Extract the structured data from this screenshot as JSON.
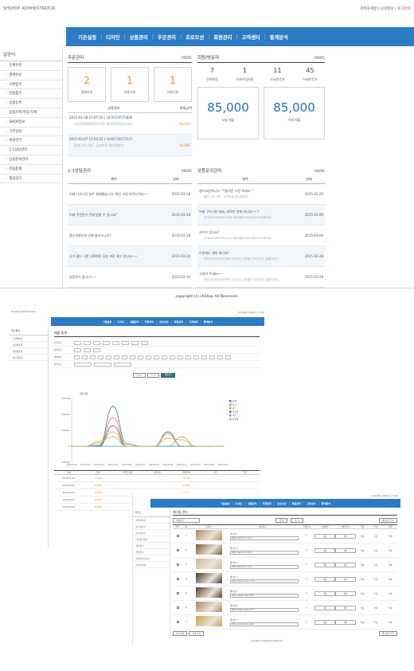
{
  "screen1": {
    "brand": "SHSHOP ADMINISTRATOR",
    "top_links": {
      "user": "관리자계정",
      "sep": " | ",
      "info": "나의정보",
      "logout": "로그아웃"
    },
    "nav": [
      "기본설정",
      "디자인",
      "상품관리",
      "주문관리",
      "프로모션",
      "회원관리",
      "고객센터",
      "통계분석"
    ],
    "sidebar": {
      "title": "샵관리",
      "items": [
        "전체주문",
        "결제완료",
        "교환접수",
        "반품접수",
        "상품등록",
        "상품목록/이동/삭제",
        "SHOP정보",
        "기본설정",
        "회원관리",
        "1:1상담관리",
        "상품문의관리",
        "마음통계",
        "월정관리"
      ]
    },
    "orders": {
      "title": "주문관리",
      "more": "MORE",
      "stats": [
        {
          "value": "2",
          "label": "결제완료"
        },
        {
          "value": "1",
          "label": "반품신청"
        },
        {
          "value": "1",
          "label": "교환신청"
        }
      ],
      "col_info": "상품정보",
      "col_amount": "결제금액",
      "rows": [
        {
          "date": "2015-03-18 15:07:50",
          "order": "3476529575808",
          "desc": "[무료]SUMMER나르쥬 제이레알럭셔리세트",
          "amount": "80,000"
        },
        {
          "date": "2015-03-07 11:53:32",
          "order": "3446729672527",
          "desc": "물안 1개 사용 - 남자포용 제이레알럭",
          "amount": "50,000"
        }
      ]
    },
    "members": {
      "title": "회원/방문자",
      "more": "MORE",
      "stats": [
        {
          "value": "7",
          "label": "전체회원"
        },
        {
          "value": "1",
          "label": "어제가입회원"
        },
        {
          "value": "11",
          "label": "오늘방문자"
        },
        {
          "value": "45",
          "label": "어제방문자"
        }
      ],
      "sales": [
        {
          "value": "85,000",
          "label": "오늘 매출"
        },
        {
          "value": "85,000",
          "label": "어제 매출"
        }
      ]
    },
    "qna": {
      "title": "1:1상담관리",
      "more": "MORE",
      "col_title": "제목",
      "col_date": "날짜",
      "rows": [
        {
          "title": "어제 나온거긴 늘쭈 결제했습니다. 확인 바랍 부탁드려요~~",
          "date": "2015-03-18"
        },
        {
          "title": "어제 주문한거 언제 받을 수 있나요?",
          "date": "2015-03-18"
        },
        {
          "title": "환신청했는데 언제 돌아오나요?",
          "date": "2015-03-18"
        },
        {
          "title": "궁기 할타 식품 (300원) 휴분 포함 재고 있나요~~",
          "date": "2015-03-10"
        },
        {
          "title": "상품문의 합니다~~",
          "date": "2015-03-10"
        }
      ]
    },
    "product_qna": {
      "title": "상품문의관리",
      "more": "MORE",
      "col_title": "제목",
      "col_date": "날짜",
      "rows": [
        {
          "title": "걸기코싱하니고, **울거운 소핑 하세요 ^",
          "sub": "물안 1개 사용 - 남자포용 제이레알럭",
          "date": "2015-03-20"
        },
        {
          "title": "어제 구아 하는데요, 바로만 언제 되나요~~?",
          "sub": "[무료]SUMMER나르쥬 제이레알럭셔리세트(러쉬레프레)",
          "date": "2015-03-09"
        },
        {
          "title": "사이즈 있나요?",
          "sub": "[무료]SUMMER나르쥬 제이레알럭셔리세트(러쉬레프레)",
          "date": "2015-03-09"
        },
        {
          "title": "이렇게도 계작 되나요?",
          "sub": "천연가나이와남자포용 디자이너 컨트롤 도자잉자이 솔롤잉자이",
          "date": "2015-02-28"
        },
        {
          "title": "고생하 주세요~~",
          "sub": "천연가나이와남자포용 디자이너 컨트롤 도자잉자이 솔롤잉자이",
          "date": "2015-02-28"
        }
      ]
    },
    "copyright": "copyright (c) shShop All Reserved."
  },
  "screen2": {
    "brand": "SHSHOP ADMINISTRATOR",
    "top_links": "관리자계정 | 나의정보 | 로그아웃",
    "nav": [
      "기본설정",
      "디자인",
      "상품관리",
      "주문관리",
      "프로모션",
      "회원관리",
      "고객센터",
      "통계분석"
    ],
    "sidebar": {
      "title": "매출통계",
      "items": [
        "기간별통계",
        "상품별통계",
        "회원별통계",
        "방문자통계"
      ]
    },
    "page_title": "매출 통계",
    "filters": [
      "검색기간",
      "검색기간",
      "결제방법",
      "검색구분"
    ],
    "buttons": {
      "search": "검 색",
      "reset": "초 기",
      "excel": "엑셀출력"
    },
    "chart_title": "매출현황",
    "legend": [
      "합계",
      "현금",
      "카드",
      "적립금",
      "쿠폰",
      "실결제"
    ],
    "table_headers": [
      "날짜",
      "합계",
      "적립금사용",
      "쿠폰사용",
      "결제금액",
      "카드",
      "현금"
    ],
    "table_rows": [
      [
        "2015-02-26",
        "10,000",
        "",
        "",
        "10,000",
        "",
        ""
      ],
      [
        "2015-03-01",
        "20,000",
        "",
        "",
        "20,000",
        "",
        ""
      ],
      [
        "2015-03-07",
        "50,000",
        "",
        "",
        "50,000",
        "",
        ""
      ],
      [
        "2015-03-12",
        "80,000",
        "",
        "",
        "80,000",
        "",
        ""
      ],
      [
        "2015-03-18",
        "85,000",
        "",
        "",
        "85,000",
        "",
        ""
      ]
    ]
  },
  "screen3": {
    "top_links": "관리자계정 | 나의정보 | 로그아웃",
    "nav": [
      "기본설정",
      "디자인",
      "상품관리",
      "주문관리",
      "프로모션",
      "회원관리",
      "고객센터",
      "통계분석"
    ],
    "sidebar": {
      "title": "디자인",
      "items": [
        "메인디자인",
        "상단디자인",
        "하단디자인",
        "게시판디자인",
        "배너관리",
        "팝업관리",
        "상세정보디자인",
        "아이콘설정"
      ]
    },
    "page_title": "배너팝 관리",
    "select_label": "전체출력",
    "buttons": {
      "search": "검 색",
      "reset": "초 기",
      "add": "배너등록 추가",
      "delete": "선택 삭제",
      "edit": "선택 수정"
    },
    "headers": [
      "선택",
      "No",
      "이미지",
      "배너정보",
      "진열순서",
      "사용여부",
      "배너위치",
      "적용",
      "수정",
      "삭제"
    ],
    "rows": [
      {
        "no": "1",
        "name": "배너팝 1",
        "url": "http://auction.co.kr/",
        "order": "1",
        "use": "사용",
        "pos": "메인",
        "thumb": "#b08a5a"
      },
      {
        "no": "2",
        "name": "배너팝 2",
        "url": "http://auction.co.kr/",
        "order": "1",
        "use": "사용",
        "pos": "메인",
        "thumb": "#7a5a3a"
      },
      {
        "no": "3",
        "name": "배너팝 3",
        "url": "http://auction.co.kr/",
        "order": "1",
        "use": "사용",
        "pos": "메인",
        "thumb": "#c7b9a0"
      },
      {
        "no": "4",
        "name": "배너팝 4",
        "url": "http://www.naver.com/",
        "order": "1",
        "use": "사용",
        "pos": "메인",
        "thumb": "#3f3a2c"
      },
      {
        "no": "5",
        "name": "배너팝 5",
        "url": "http://www.nate.com/",
        "order": "1",
        "use": "사용",
        "pos": "메인",
        "thumb": "#5a4030"
      },
      {
        "no": "6",
        "name": "배너팝 6",
        "url": "http://www.nate.com/",
        "order": "1",
        "use": "사용",
        "pos": "메인",
        "thumb": "#a88b5b"
      },
      {
        "no": "7",
        "name": "배너팝 7",
        "url": "http://www.nate.com/",
        "order": "1",
        "use": "사용",
        "pos": "메인",
        "thumb": "#c9a24a"
      }
    ],
    "copyright": "copyright (c) shShop All Reserved."
  },
  "colors": {
    "nav_blue": "#2c7bc6",
    "accent_orange": "#f28b1a",
    "sale_blue": "#1f6fc0",
    "logout_red": "#dd3333"
  },
  "chart_data": {
    "type": "line",
    "title": "매출현황",
    "x": [
      "2015-02-22",
      "2015-02-26",
      "2015-03-01",
      "2015-03-05",
      "2015-03-08",
      "2015-03-12",
      "2015-03-15",
      "2015-03-18",
      "2015-03-21",
      "2015-03-25",
      "2015-03-28",
      "2015-03-31"
    ],
    "ylim": [
      -100000,
      300000
    ],
    "series": [
      {
        "name": "합계",
        "color": "#3b6fb6",
        "values": [
          0,
          0,
          5000,
          250000,
          15000,
          0,
          0,
          90000,
          0,
          0,
          0,
          0
        ]
      },
      {
        "name": "현금",
        "color": "#e07b2c",
        "values": [
          0,
          0,
          0,
          180000,
          0,
          0,
          0,
          80000,
          0,
          0,
          0,
          0
        ]
      },
      {
        "name": "카드",
        "color": "#8bbd3a",
        "values": [
          0,
          0,
          30000,
          60000,
          0,
          0,
          0,
          0,
          60000,
          0,
          0,
          0
        ]
      },
      {
        "name": "적립금",
        "color": "#6a4fa0",
        "values": [
          0,
          0,
          0,
          130000,
          0,
          0,
          0,
          0,
          0,
          0,
          0,
          0
        ]
      },
      {
        "name": "쿠폰",
        "color": "#3db0c4",
        "values": [
          0,
          0,
          0,
          0,
          0,
          0,
          0,
          0,
          0,
          0,
          0,
          0
        ]
      },
      {
        "name": "실결제",
        "color": "#e0a640",
        "values": [
          0,
          0,
          20000,
          90000,
          0,
          0,
          0,
          50000,
          40000,
          0,
          0,
          0
        ]
      }
    ]
  }
}
